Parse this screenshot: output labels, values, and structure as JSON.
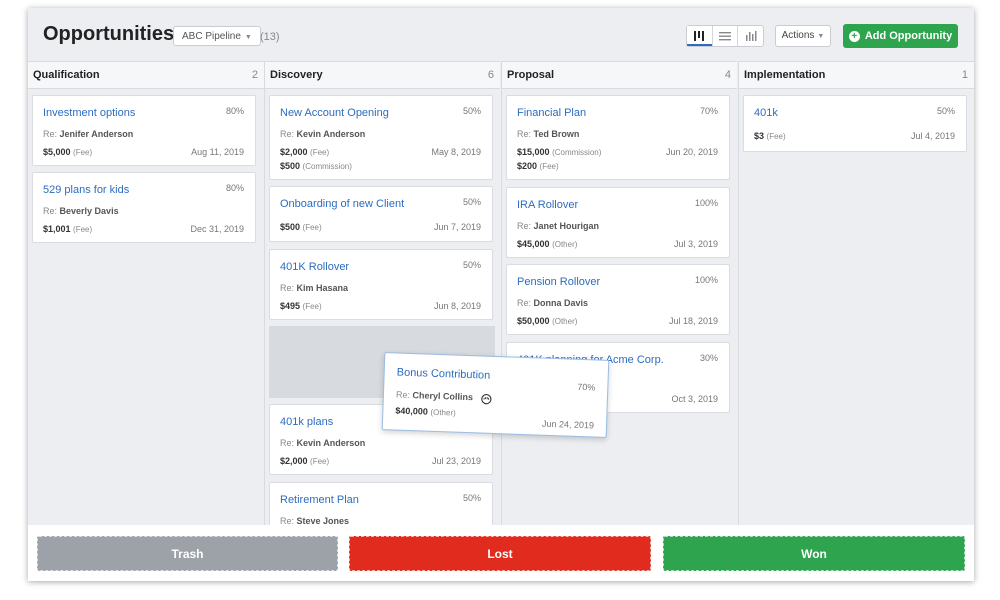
{
  "header": {
    "title": "Opportunities",
    "pipeline": "ABC Pipeline",
    "total_count": "(13)",
    "actions_label": "Actions",
    "add_label": "Add Opportunity"
  },
  "columns": [
    {
      "name": "Qualification",
      "count": "2"
    },
    {
      "name": "Discovery",
      "count": "6"
    },
    {
      "name": "Proposal",
      "count": "4"
    },
    {
      "name": "Implementation",
      "count": "1"
    }
  ],
  "cards": {
    "qualification": [
      {
        "title": "Investment options",
        "pct": "80%",
        "re_prefix": "Re:",
        "re": "Jenifer Anderson",
        "amount": "$5,000",
        "type": "(Fee)",
        "date": "Aug 11, 2019"
      },
      {
        "title": "529 plans for kids",
        "pct": "80%",
        "re_prefix": "Re:",
        "re": "Beverly Davis",
        "amount": "$1,001",
        "type": "(Fee)",
        "date": "Dec 31, 2019"
      }
    ],
    "discovery": [
      {
        "title": "New Account Opening",
        "pct": "50%",
        "re_prefix": "Re:",
        "re": "Kevin Anderson",
        "amount": "$2,000",
        "type": "(Fee)",
        "date": "May 8, 2019",
        "amount2": "$500",
        "type2": "(Commission)"
      },
      {
        "title": "Onboarding of new Client",
        "pct": "50%",
        "amount": "$500",
        "type": "(Fee)",
        "date": "Jun 7, 2019"
      },
      {
        "title": "401K Rollover",
        "pct": "50%",
        "re_prefix": "Re:",
        "re": "Kim Hasana",
        "amount": "$495",
        "type": "(Fee)",
        "date": "Jun 8, 2019"
      },
      {
        "title": "401k plans",
        "pct": "",
        "re_prefix": "Re:",
        "re": "Kevin Anderson",
        "amount": "$2,000",
        "type": "(Fee)",
        "date": "Jul 23, 2019"
      },
      {
        "title": "Retirement Plan",
        "pct": "50%",
        "re_prefix": "Re:",
        "re": "Steve Jones"
      }
    ],
    "proposal": [
      {
        "title": "Financial Plan",
        "pct": "70%",
        "re_prefix": "Re:",
        "re": "Ted Brown",
        "amount": "$15,000",
        "type": "(Commission)",
        "date": "Jun 20, 2019",
        "amount2": "$200",
        "type2": "(Fee)"
      },
      {
        "title": "IRA Rollover",
        "pct": "100%",
        "re_prefix": "Re:",
        "re": "Janet Hourigan",
        "amount": "$45,000",
        "type": "(Other)",
        "date": "Jul 3, 2019"
      },
      {
        "title": "Pension Rollover",
        "pct": "100%",
        "re_prefix": "Re:",
        "re": "Donna Davis",
        "amount": "$50,000",
        "type": "(Other)",
        "date": "Jul 18, 2019"
      },
      {
        "title": "401K planning for Acme Corp.",
        "pct": "30%",
        "date": "Oct 3, 2019"
      }
    ],
    "implementation": [
      {
        "title": "401k",
        "pct": "50%",
        "amount": "$3",
        "type": "(Fee)",
        "date": "Jul 4, 2019"
      }
    ]
  },
  "dragging_card": {
    "title": "Bonus Contribution",
    "pct": "70%",
    "re_prefix": "Re:",
    "re": "Cheryl Collins",
    "amount": "$40,000",
    "type": "(Other)",
    "date": "Jun 24, 2019"
  },
  "drop_zones": {
    "trash": "Trash",
    "lost": "Lost",
    "won": "Won"
  },
  "icons": {
    "board_view": "kanban-icon",
    "list_view": "list-icon",
    "chart_view": "bar-chart-icon",
    "add": "plus-circle-icon",
    "drag_cursor": "grab-hand-icon"
  },
  "colors": {
    "accent": "#2d6cbf",
    "add_button": "#2ea44f",
    "lost": "#e22b1f",
    "won": "#2ea44f",
    "trash": "#9da1a8"
  }
}
